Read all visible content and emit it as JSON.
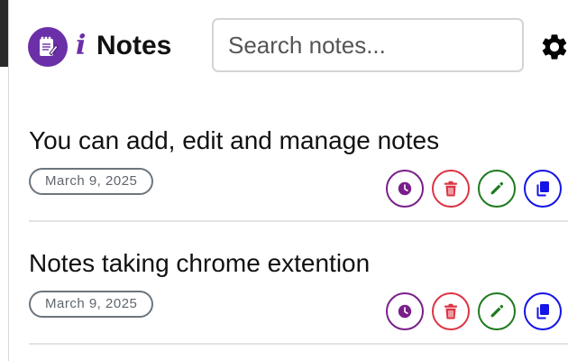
{
  "header": {
    "info_glyph": "i",
    "title": "Notes",
    "search_placeholder": "Search notes...",
    "logo_icon": "notepad-icon",
    "settings_icon": "gear-icon"
  },
  "notes": [
    {
      "title": "You can add, edit and manage notes",
      "date": "March 9, 2025"
    },
    {
      "title": "Notes taking chrome extention",
      "date": "March 9, 2025"
    }
  ],
  "actions": [
    {
      "icon": "clock-icon",
      "color": "#7a1f8a"
    },
    {
      "icon": "trash-icon",
      "color": "#dc3545"
    },
    {
      "icon": "pencil-icon",
      "color": "#1e7a1e"
    },
    {
      "icon": "copy-icon",
      "color": "#1414e6"
    }
  ],
  "colors": {
    "brand": "#6b2fa8"
  }
}
